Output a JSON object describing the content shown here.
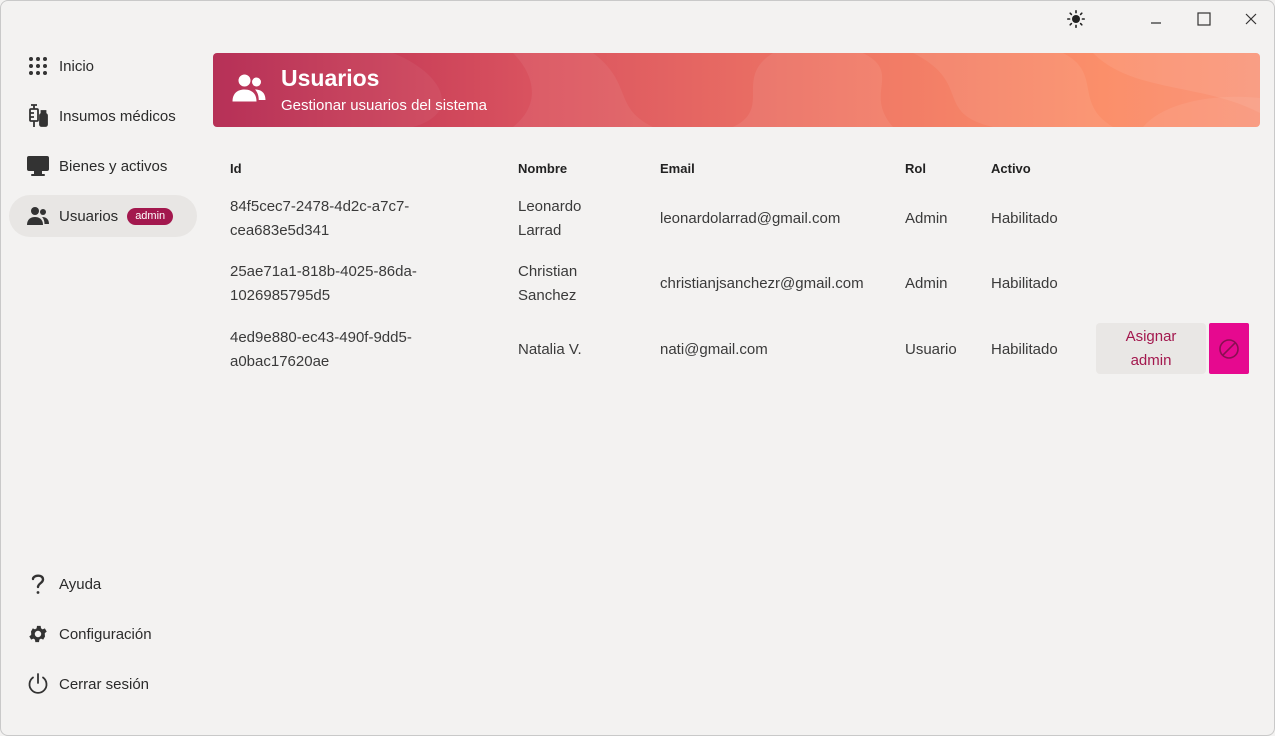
{
  "window": {
    "theme_icon": "sun-icon",
    "minimize_icon": "minimize-icon",
    "maximize_icon": "maximize-icon",
    "close_icon": "close-icon"
  },
  "sidebar": {
    "items": [
      {
        "label": "Inicio",
        "icon": "grid-dots-icon"
      },
      {
        "label": "Insumos médicos",
        "icon": "medical-supplies-icon"
      },
      {
        "label": "Bienes y activos",
        "icon": "monitor-icon"
      },
      {
        "label": "Usuarios",
        "icon": "users-icon",
        "badge": "admin",
        "active": true
      }
    ],
    "bottom_items": [
      {
        "label": "Ayuda",
        "icon": "help-icon"
      },
      {
        "label": "Configuración",
        "icon": "gear-icon"
      },
      {
        "label": "Cerrar sesión",
        "icon": "power-icon"
      }
    ]
  },
  "header": {
    "title": "Usuarios",
    "subtitle": "Gestionar usuarios del sistema",
    "icon": "users-icon"
  },
  "table": {
    "columns": {
      "id": "Id",
      "name": "Nombre",
      "email": "Email",
      "role": "Rol",
      "active": "Activo"
    },
    "rows": [
      {
        "id_line1": "84f5cec7-2478-4d2c-a7c7-",
        "id_line2": "cea683e5d341",
        "name_line1": "Leonardo",
        "name_line2": "Larrad",
        "email": "leonardolarrad@gmail.com",
        "role": "Admin",
        "active": "Habilitado"
      },
      {
        "id_line1": "25ae71a1-818b-4025-86da-",
        "id_line2": "1026985795d5",
        "name_line1": "Christian",
        "name_line2": "Sanchez",
        "email": "christianjsanchezr@gmail.com",
        "role": "Admin",
        "active": "Habilitado"
      },
      {
        "id_line1": "4ed9e880-ec43-490f-9dd5-",
        "id_line2": "a0bac17620ae",
        "name_line1": "Natalia V.",
        "name_line2": "",
        "email": "nati@gmail.com",
        "role": "Usuario",
        "active": "Habilitado",
        "assign_label_line1": "Asignar",
        "assign_label_line2": "admin",
        "block_icon": "block-icon"
      }
    ]
  },
  "colors": {
    "accent": "#a3184e",
    "block_button": "#e6098f",
    "banner_start": "#b3264f",
    "banner_end": "#f9967b"
  }
}
